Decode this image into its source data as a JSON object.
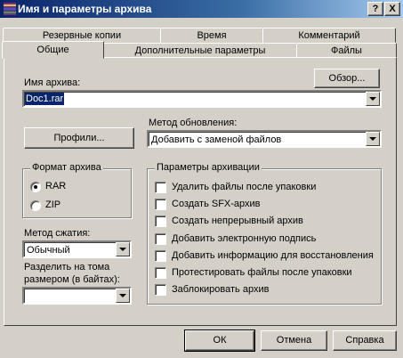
{
  "window": {
    "title": "Имя и параметры архива"
  },
  "titlebar_buttons": {
    "help": "?",
    "close": "X"
  },
  "tabs_back": [
    "Резервные копии",
    "Время",
    "Комментарий"
  ],
  "tabs_front": [
    "Общие",
    "Дополнительные параметры",
    "Файлы"
  ],
  "archive_name": {
    "label": "Имя архива:",
    "value": "Doc1.rar",
    "browse": "Обзор..."
  },
  "profiles_button": "Профили...",
  "update_method": {
    "label": "Метод обновления:",
    "value": "Добавить с заменой файлов"
  },
  "archive_format": {
    "title": "Формат архива",
    "options": [
      "RAR",
      "ZIP"
    ],
    "selected": "RAR"
  },
  "compression": {
    "label": "Метод сжатия:",
    "value": "Обычный"
  },
  "split": {
    "label_line1": "Разделить на тома",
    "label_line2": "размером (в байтах):",
    "value": ""
  },
  "archive_options": {
    "title": "Параметры архивации",
    "items": [
      {
        "label": "Удалить файлы после упаковки",
        "checked": false
      },
      {
        "label": "Создать SFX-архив",
        "checked": false
      },
      {
        "label": "Создать непрерывный архив",
        "checked": false
      },
      {
        "label": "Добавить электронную подпись",
        "checked": false
      },
      {
        "label": "Добавить информацию для восстановления",
        "checked": false
      },
      {
        "label": "Протестировать файлы после упаковки",
        "checked": false
      },
      {
        "label": "Заблокировать архив",
        "checked": false
      }
    ]
  },
  "buttons": {
    "ok": "ОК",
    "cancel": "Отмена",
    "help": "Справка"
  },
  "colors": {
    "titlebar_start": "#0a246a",
    "titlebar_end": "#a6caf0",
    "face": "#d4d0c8",
    "selection": "#0a246a"
  }
}
